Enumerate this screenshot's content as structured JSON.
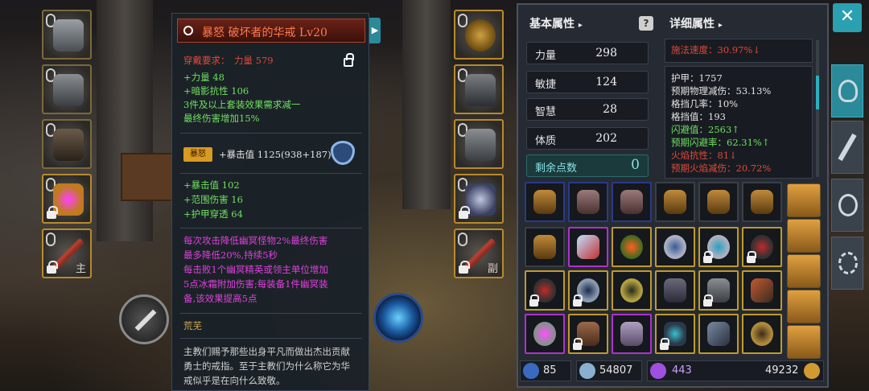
{
  "item_tooltip": {
    "title": "暴怒  破坏者的华戒  Lv20",
    "requirement_label": "穿戴要求：",
    "requirement_value": "力量 579",
    "base_stats": [
      "+力量 48",
      "+暗影抗性 106",
      "3件及以上套装效果需求减一",
      "最终伤害增加15%"
    ],
    "rage_badge": "暴怒",
    "rage_stat": "+暴击值 1125(938+187)",
    "extra_stats": [
      "+暴击值 102",
      "+范围伤害 16",
      "+护甲穿透 64"
    ],
    "set_effect": [
      "每次攻击降低幽冥怪物2%最终伤害",
      "最多降低20%,持续5秒",
      "每击败1个幽冥精英或领主单位增加",
      "5点冰霜附加伤害;每装备1件幽冥装",
      "备,该效果提高5点"
    ],
    "flavor_title": "荒芜",
    "flavor_text": [
      "主教们赐予那些出身平凡而做出杰出贡献",
      "勇士的戒指。至于主教们为什么称它为华",
      "戒似乎是在向什么致敬。"
    ]
  },
  "equip_slots": {
    "left_main_tag": "主",
    "right_off_tag": "副"
  },
  "stats_panel": {
    "basic_tab": "基本属性",
    "detail_tab": "详细属性",
    "basic": [
      {
        "label": "力量",
        "value": "298"
      },
      {
        "label": "敏捷",
        "value": "124"
      },
      {
        "label": "智慧",
        "value": "28"
      },
      {
        "label": "体质",
        "value": "202"
      }
    ],
    "remaining_label": "剩余点数",
    "remaining_value": "0",
    "detail_top": "施法速度：30.97%↓",
    "detail": [
      {
        "text": "护甲：1757",
        "color": "#e4e4e4"
      },
      {
        "text": "预期物理减伤：53.13%",
        "color": "#e4e4e4"
      },
      {
        "text": "格挡几率：10%",
        "color": "#e4e4e4"
      },
      {
        "text": "格挡值：193",
        "color": "#e4e4e4"
      },
      {
        "text": "闪避值：2563↑",
        "color": "#6fe060"
      },
      {
        "text": "预期闪避率：62.31%↑",
        "color": "#6fe060"
      },
      {
        "text": "火焰抗性：81↓",
        "color": "#e04a3a"
      },
      {
        "text": "预期火焰减伤：20.72%",
        "color": "#e04a3a"
      }
    ]
  },
  "currency": {
    "attack_power": "85",
    "defense": "54807",
    "gems": "443",
    "gold": "49232"
  },
  "colors": {
    "accent": "#2aa0b0",
    "legendary_border": "#c09a2a",
    "epic_border": "#b030d0",
    "stat_up": "#6fe060",
    "stat_down": "#e04a3a"
  }
}
